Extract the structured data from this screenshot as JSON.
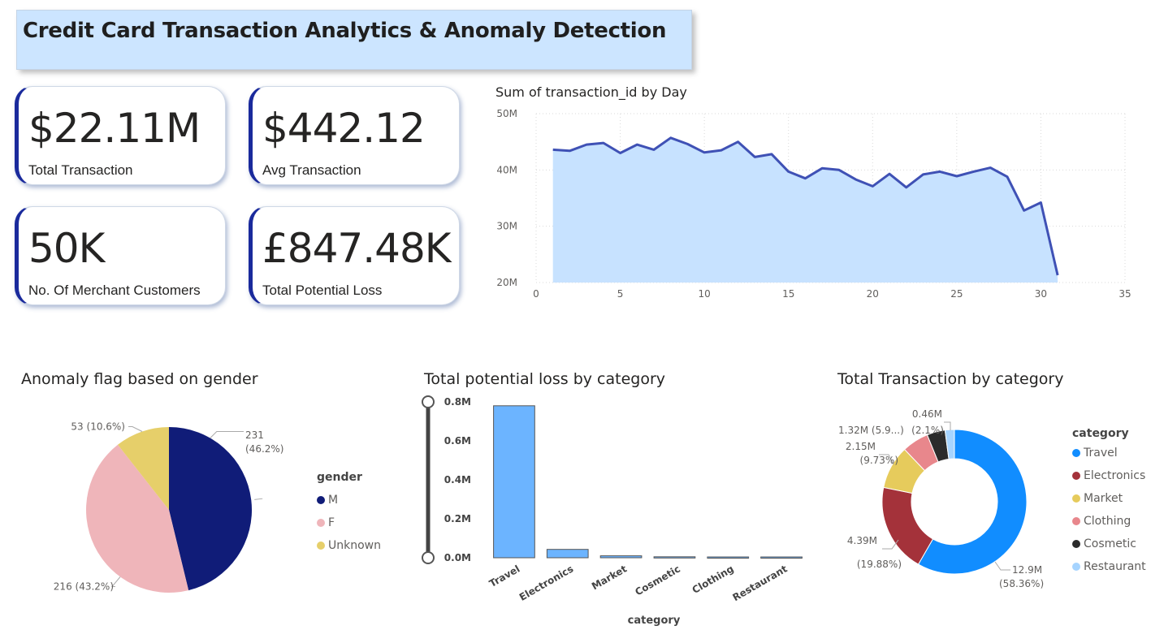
{
  "page": {
    "title": "Credit Card Transaction Analytics & Anomaly Detection"
  },
  "kpis": [
    {
      "value": "$22.11M",
      "label": "Total Transaction"
    },
    {
      "value": "$442.12",
      "label": "Avg Transaction"
    },
    {
      "value": "50K",
      "label": "No. Of Merchant Customers"
    },
    {
      "value": "£847.48K",
      "label": "Total Potential Loss"
    }
  ],
  "visual_titles": {
    "line": "Sum of transaction_id by Day",
    "gender": "Anomaly flag based on gender",
    "loss": "Total potential loss by category",
    "category": "Total Transaction by category"
  },
  "legends": {
    "gender": {
      "title": "gender",
      "items": [
        "M",
        "F",
        "Unknown"
      ]
    },
    "category": {
      "title": "category",
      "items": [
        "Travel",
        "Electronics",
        "Market",
        "Clothing",
        "Cosmetic",
        "Restaurant"
      ]
    }
  },
  "colors": {
    "line_stroke": "#3f51b5",
    "area_fill": "#c7e2ff",
    "gender_M": "#101c78",
    "gender_F": "#efb5ba",
    "gender_Unknown": "#e6cf6a",
    "bar_fill": "#6cb4ff",
    "cat_Travel": "#118dff",
    "cat_Electronics": "#a4323a",
    "cat_Market": "#e6cb5c",
    "cat_Clothing": "#e8878c",
    "cat_Cosmetic": "#2b2b2b",
    "cat_Restaurant": "#a6d4ff"
  },
  "chart_data": [
    {
      "id": "line",
      "type": "area",
      "title": "Sum of transaction_id by Day",
      "x": [
        1,
        2,
        3,
        4,
        5,
        6,
        7,
        8,
        9,
        10,
        11,
        12,
        13,
        14,
        15,
        16,
        17,
        18,
        19,
        20,
        21,
        22,
        23,
        24,
        25,
        26,
        27,
        28,
        29,
        30,
        31
      ],
      "y": [
        43.6,
        43.4,
        44.5,
        44.8,
        43.0,
        44.5,
        43.6,
        45.7,
        44.6,
        43.1,
        43.5,
        45.0,
        42.3,
        42.8,
        39.7,
        38.5,
        40.3,
        40.0,
        38.3,
        37.1,
        39.3,
        36.9,
        39.2,
        39.7,
        38.9,
        39.7,
        40.4,
        38.8,
        32.8,
        34.2,
        21.3
      ],
      "xlim": [
        0,
        35
      ],
      "xticks": [
        0,
        5,
        10,
        15,
        20,
        25,
        30,
        35
      ],
      "ylim": [
        20,
        50
      ],
      "yticks": [
        20,
        30,
        40,
        50
      ],
      "ytick_labels": [
        "20M",
        "30M",
        "40M",
        "50M"
      ],
      "grid": true
    },
    {
      "id": "gender",
      "type": "pie",
      "title": "Anomaly flag based on gender",
      "categories": [
        "M",
        "F",
        "Unknown"
      ],
      "values": [
        231,
        216,
        53
      ],
      "labels": [
        "231",
        "216 (43.2%)",
        "53 (10.6%)"
      ],
      "sublabels": [
        "(46.2%)",
        "",
        ""
      ],
      "legend": "right"
    },
    {
      "id": "loss",
      "type": "bar",
      "title": "Total potential loss by category",
      "categories": [
        "Travel",
        "Electronics",
        "Market",
        "Cosmetic",
        "Clothing",
        "Restaurant"
      ],
      "values": [
        0.78,
        0.043,
        0.01,
        0.005,
        0.004,
        0.004
      ],
      "xlabel": "category",
      "ylim": [
        0,
        0.8
      ],
      "yticks": [
        0,
        0.2,
        0.4,
        0.6,
        0.8
      ],
      "ytick_labels": [
        "0.0M",
        "0.2M",
        "0.4M",
        "0.6M",
        "0.8M"
      ]
    },
    {
      "id": "category",
      "type": "pie",
      "title": "Total Transaction by category",
      "categories": [
        "Travel",
        "Electronics",
        "Market",
        "Clothing",
        "Cosmetic",
        "Restaurant"
      ],
      "values": [
        12.9,
        4.39,
        2.15,
        1.32,
        0.9,
        0.46
      ],
      "label_lines": [
        [
          "12.9M",
          "(58.36%)"
        ],
        [
          "4.39M",
          "(19.88%)"
        ],
        [
          "2.15M",
          "(9.73%)"
        ],
        [
          "1.32M (5.9...)"
        ],
        [],
        [
          "0.46M",
          "(2.1%)"
        ]
      ],
      "legend": "right"
    }
  ]
}
